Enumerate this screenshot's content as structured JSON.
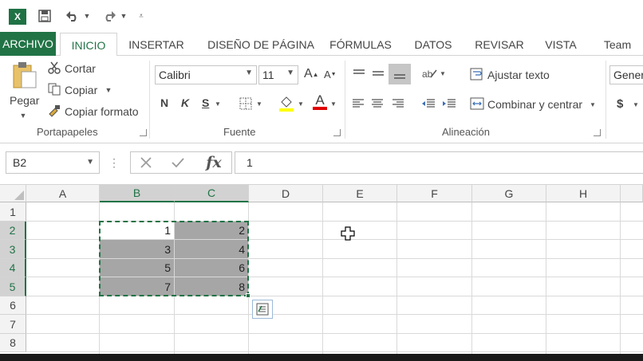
{
  "quick_access": {
    "app_icon": "excel-icon",
    "save_icon": "save-icon",
    "undo_icon": "undo-icon",
    "redo_icon": "redo-icon",
    "customize_icon": "customize-icon"
  },
  "tabs": [
    {
      "label": "ARCHIVO"
    },
    {
      "label": "INICIO"
    },
    {
      "label": "INSERTAR"
    },
    {
      "label": "DISEÑO DE PÁGINA"
    },
    {
      "label": "FÓRMULAS"
    },
    {
      "label": "DATOS"
    },
    {
      "label": "REVISAR"
    },
    {
      "label": "VISTA"
    },
    {
      "label": "Team"
    }
  ],
  "ribbon": {
    "clipboard": {
      "paste": "Pegar",
      "cut": "Cortar",
      "copy": "Copiar",
      "format_painter": "Copiar formato",
      "label": "Portapapeles"
    },
    "font": {
      "name": "Calibri",
      "size": "11",
      "grow": "A",
      "shrink": "A",
      "bold": "N",
      "italic": "K",
      "underline": "S",
      "color_letter": "A",
      "fill_color": "#ffff00",
      "font_color": "#e00000",
      "label": "Fuente"
    },
    "alignment": {
      "wrap": "Ajustar texto",
      "merge": "Combinar y centrar",
      "label": "Alineación"
    },
    "number": {
      "format": "Gener",
      "currency": "$"
    }
  },
  "formula_bar": {
    "name_box": "B2",
    "value": "1",
    "fx": "fx"
  },
  "sheet": {
    "columns": [
      "A",
      "B",
      "C",
      "D",
      "E",
      "F",
      "G",
      "H"
    ],
    "rows": [
      "1",
      "2",
      "3",
      "4",
      "5",
      "6",
      "7",
      "8"
    ],
    "cells": {
      "B2": "1",
      "C2": "2",
      "B3": "3",
      "C3": "4",
      "B4": "5",
      "C4": "6",
      "B5": "7",
      "C5": "8"
    },
    "selection_color": "#217346"
  }
}
